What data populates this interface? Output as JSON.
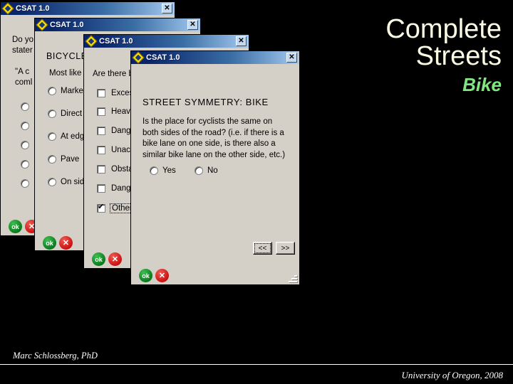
{
  "slide": {
    "title_line1": "Complete",
    "title_line2": "Streets",
    "subtitle": "Bike",
    "title_color": "#fbfbe4",
    "subtitle_color": "#7ee87e",
    "background_color": "#000000"
  },
  "footer": {
    "author": "Marc Schlossberg, PhD",
    "source": "University of Oregon, 2008"
  },
  "common": {
    "app_title": "CSAT 1.0",
    "close_label": "✕",
    "ok_label": "ok",
    "cancel_label": "✕",
    "titlebar_color_start": "#0a246a",
    "titlebar_color_end": "#a6caf0",
    "window_face_color": "#d4d0c8"
  },
  "windows": [
    {
      "id": "window-1",
      "title": "CSAT 1.0",
      "has_close_button": true,
      "prompt_line1": "Do yo",
      "prompt_line2": "stater",
      "quote_line1": "\"A c",
      "quote_line2": "coml",
      "options": [
        "",
        "",
        "",
        "",
        ""
      ]
    },
    {
      "id": "window-2",
      "title": "CSAT 1.0",
      "has_close_button": true,
      "heading": "BICYCLE",
      "prompt": "Most like",
      "options": [
        "Marke",
        "Direct",
        "At edg",
        "Pave",
        "On sid"
      ]
    },
    {
      "id": "window-3",
      "title": "CSAT 1.0",
      "has_close_button": true,
      "prompt": "Are there b",
      "checkboxes": [
        {
          "label": "Exces",
          "checked": false,
          "focused": false
        },
        {
          "label": "Heavy",
          "checked": false,
          "focused": false
        },
        {
          "label": "Dange",
          "checked": false,
          "focused": false
        },
        {
          "label": "Unacc",
          "checked": false,
          "focused": false
        },
        {
          "label": "Obsta",
          "checked": false,
          "focused": false
        },
        {
          "label": "Dange",
          "checked": false,
          "focused": false
        },
        {
          "label": "Other.",
          "checked": true,
          "focused": true
        }
      ]
    },
    {
      "id": "window-4",
      "title": "CSAT 1.0",
      "has_close_button": true,
      "heading": "STREET SYMMETRY: BIKE",
      "question": "Is the place for cyclists the same on both sides of the road? (i.e. if there is a bike lane on one side, is there also a similar bike lane on the other side, etc.)",
      "options": [
        "Yes",
        "No"
      ],
      "nav_prev": "<<",
      "nav_next": ">>"
    }
  ]
}
